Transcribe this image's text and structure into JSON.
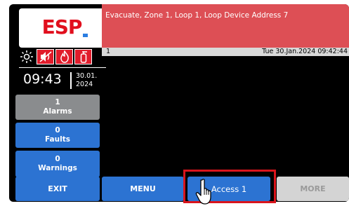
{
  "logo": {
    "text": "ESP"
  },
  "status_icons": [
    "sun-icon",
    "sounder-muted-icon",
    "fire-icon",
    "extinguisher-icon"
  ],
  "clock": {
    "time": "09:43",
    "date_line1": "30.01.",
    "date_line2": "2024"
  },
  "side_buttons": {
    "alarms": {
      "count": "1",
      "label": "Alarms"
    },
    "faults": {
      "count": "0",
      "label": "Faults"
    },
    "warnings": {
      "count": "0",
      "label": "Warnings"
    }
  },
  "message": {
    "text": "Evacuate, Zone 1, Loop 1, Loop Device Address 7",
    "index": "1",
    "timestamp": "Tue 30.Jan.2024 09:42:44"
  },
  "bottom_buttons": {
    "exit": "EXIT",
    "menu": "MENU",
    "access": "Access 1",
    "more": "MORE"
  },
  "colors": {
    "accent_blue": "#2c73d2",
    "alarm_red": "#dd4f55",
    "brand_red": "#e10f1d",
    "disabled_grey": "#d4d4d4"
  }
}
